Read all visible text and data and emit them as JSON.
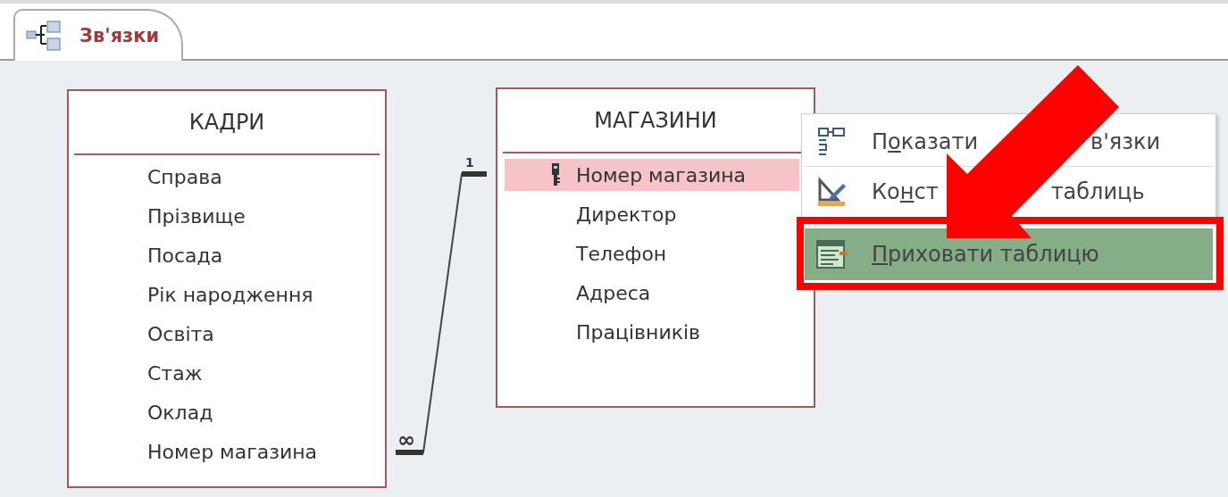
{
  "tab": {
    "label": "Зв'язки",
    "selected": true
  },
  "tables": [
    {
      "title": "КАДРИ",
      "fields": [
        {
          "name": "Справа",
          "key": false,
          "selected": false
        },
        {
          "name": "Прізвище",
          "key": false,
          "selected": false
        },
        {
          "name": "Посада",
          "key": false,
          "selected": false
        },
        {
          "name": "Рік народження",
          "key": false,
          "selected": false
        },
        {
          "name": "Освіта",
          "key": false,
          "selected": false
        },
        {
          "name": "Стаж",
          "key": false,
          "selected": false
        },
        {
          "name": "Оклад",
          "key": false,
          "selected": false
        },
        {
          "name": "Номер магазина",
          "key": false,
          "selected": false
        }
      ]
    },
    {
      "title": "МАГАЗИНИ",
      "fields": [
        {
          "name": "Номер магазина",
          "key": true,
          "selected": true
        },
        {
          "name": "Директор",
          "key": false,
          "selected": false
        },
        {
          "name": "Телефон",
          "key": false,
          "selected": false
        },
        {
          "name": "Адреса",
          "key": false,
          "selected": false
        },
        {
          "name": "Працівників",
          "key": false,
          "selected": false
        }
      ]
    }
  ],
  "relationship": {
    "one_label": "1",
    "many_label": "∞"
  },
  "context_menu": {
    "items": [
      {
        "kind": "show-links",
        "parts": [
          [
            {
              "text": "П",
              "underlined": false
            },
            {
              "text": "о",
              "underlined": true
            },
            {
              "text": "казати",
              "underlined": false
            }
          ],
          [
            {
              "text": "в'язки",
              "underlined": false
            }
          ]
        ],
        "selected": false
      },
      {
        "kind": "design",
        "parts": [
          [
            {
              "text": "Ко",
              "underlined": false
            },
            {
              "text": "н",
              "underlined": true
            },
            {
              "text": "ст",
              "underlined": false
            }
          ],
          [
            {
              "text": "таблиць",
              "underlined": false
            }
          ]
        ],
        "selected": false
      },
      {
        "kind": "hide",
        "parts": [
          [
            {
              "text": "П",
              "underlined": true
            },
            {
              "text": "риховати таблицю",
              "underlined": false
            }
          ]
        ],
        "selected": true
      }
    ]
  }
}
